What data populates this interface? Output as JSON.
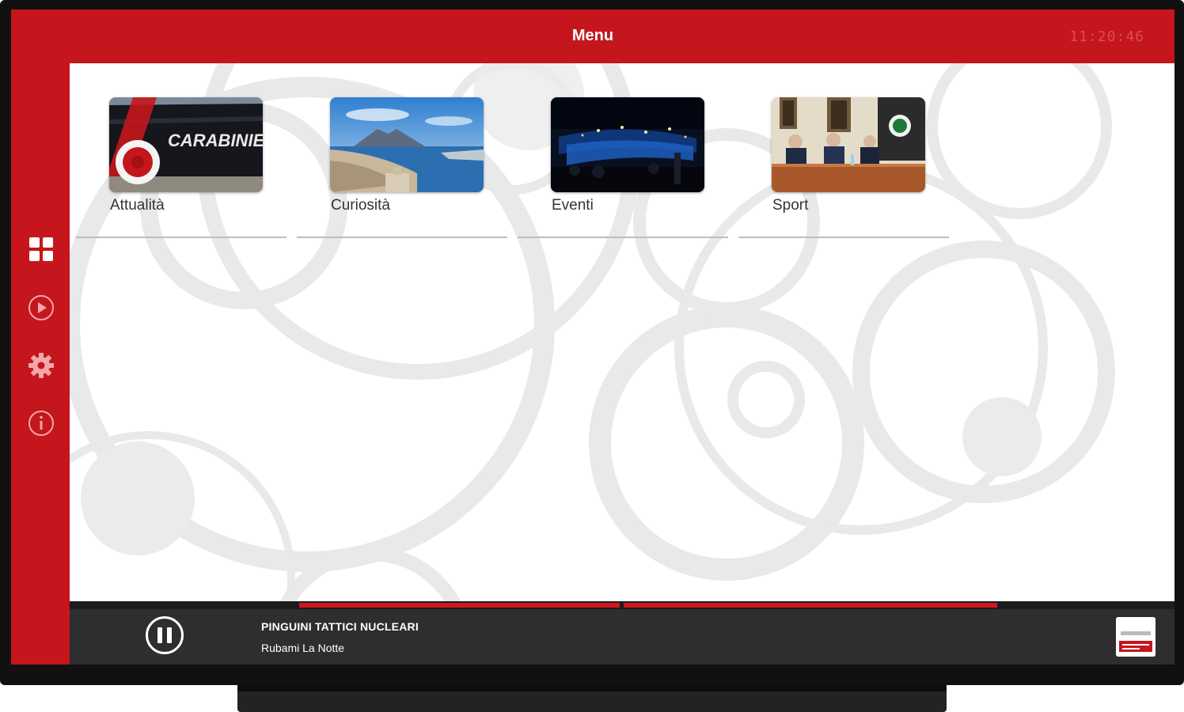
{
  "header": {
    "title": "Menu",
    "clock": "11:20:46"
  },
  "sidebar": {
    "items": [
      {
        "id": "grid",
        "icon": "grid-icon"
      },
      {
        "id": "play",
        "icon": "play-circle-icon"
      },
      {
        "id": "settings",
        "icon": "gear-icon"
      },
      {
        "id": "info",
        "icon": "info-icon"
      }
    ]
  },
  "categories": [
    {
      "label": "Attualità",
      "icon": "news-thumbnail"
    },
    {
      "label": "Curiosità",
      "icon": "city-thumbnail"
    },
    {
      "label": "Eventi",
      "icon": "event-thumbnail"
    },
    {
      "label": "Sport",
      "icon": "sport-thumbnail"
    }
  ],
  "player": {
    "artist": "PINGUINI TATTICI NUCLEARI",
    "song": "Rubami La Notte",
    "state": "playing"
  },
  "colors": {
    "brand_red": "#c4161c",
    "player_bg": "#2e2e2e",
    "progress_red": "#d2161e"
  }
}
